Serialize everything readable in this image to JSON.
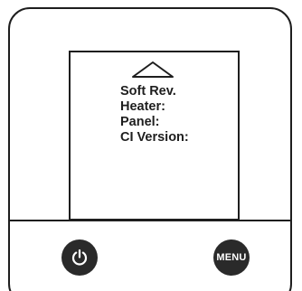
{
  "display": {
    "nav_icon": "chevron-up-icon",
    "lines": [
      "Soft Rev.",
      "Heater:",
      "Panel:",
      "CI Version:"
    ]
  },
  "controls": {
    "power_icon": "power-icon",
    "menu_label": "MENU"
  },
  "colors": {
    "outline": "#1e1e1e",
    "button_fill": "#2a2a2a",
    "button_text": "#ffffff",
    "background": "#ffffff"
  }
}
